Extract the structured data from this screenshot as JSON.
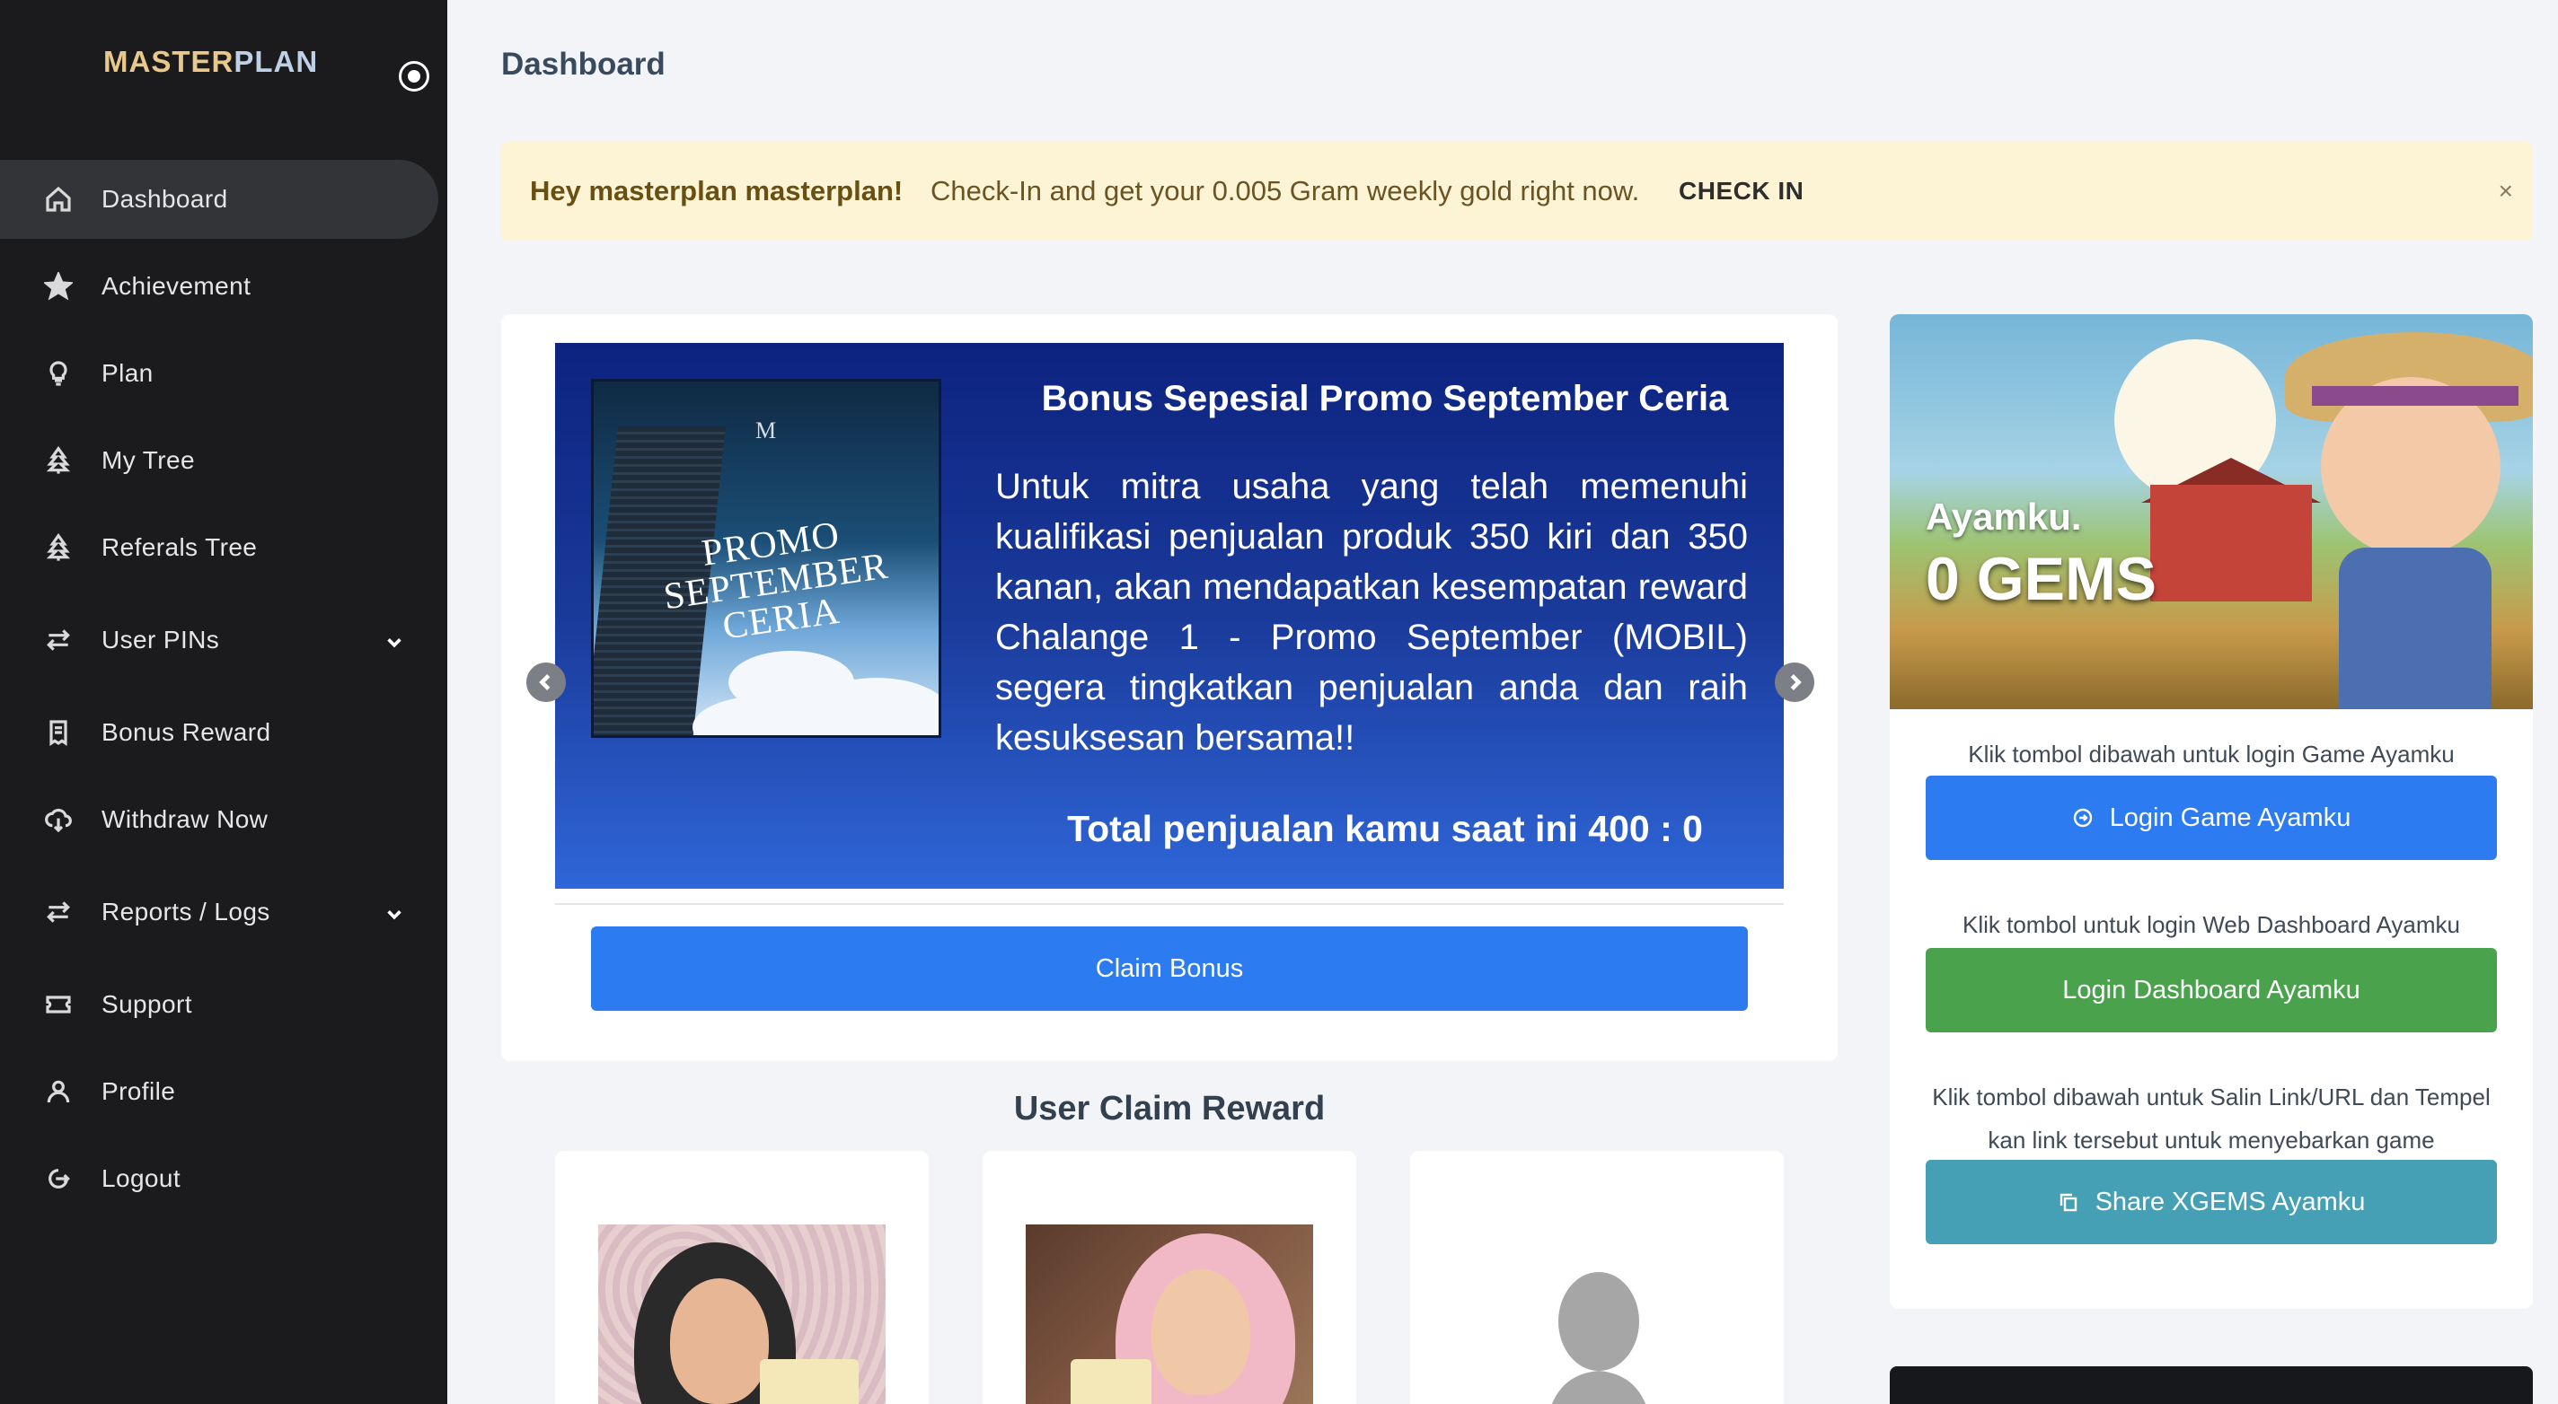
{
  "app": {
    "logo_master": "MASTER",
    "logo_plan": "PLAN"
  },
  "sidebar": {
    "items": [
      {
        "label": "Dashboard",
        "icon": "home-icon",
        "active": true
      },
      {
        "label": "Achievement",
        "icon": "star-icon"
      },
      {
        "label": "Plan",
        "icon": "lightbulb-icon"
      },
      {
        "label": "My Tree",
        "icon": "tree-icon"
      },
      {
        "label": "Referals Tree",
        "icon": "tree-icon"
      },
      {
        "label": "User PINs",
        "icon": "swap-icon",
        "has_submenu": true
      },
      {
        "label": "Bonus Reward",
        "icon": "receipt-icon"
      },
      {
        "label": "Withdraw Now",
        "icon": "cloud-download-icon"
      },
      {
        "label": "Reports / Logs",
        "icon": "swap-icon",
        "has_submenu": true
      },
      {
        "label": "Support",
        "icon": "ticket-icon"
      },
      {
        "label": "Profile",
        "icon": "user-icon"
      },
      {
        "label": "Logout",
        "icon": "logout-icon"
      }
    ]
  },
  "header": {
    "title": "Dashboard"
  },
  "alert": {
    "greeting": "Hey masterplan masterplan!",
    "message": "Check-In and get your 0.005 Gram weekly gold right now.",
    "action": "CHECK IN",
    "close": "×"
  },
  "promo": {
    "image_text": "PROMO SEPTEMBER CERIA",
    "image_logo": "M",
    "title": "Bonus Sepesial Promo September Ceria",
    "body": "Untuk mitra usaha yang telah memenuhi kualifikasi penjualan produk 350 kiri dan 350 kanan, akan mendapatkan kesempatan reward Chalange 1 - Promo September (MOBIL) segera tingkatkan penjualan anda dan raih kesuksesan bersama!!",
    "total": "Total penjualan kamu saat ini 400 : 0",
    "claim_button": "Claim Bonus"
  },
  "claims": {
    "heading": "User Claim Reward"
  },
  "game": {
    "label": "Ayamku.",
    "gems": "0 GEMS",
    "hint_login_game": "Klik tombol dibawah untuk login Game Ayamku",
    "btn_login_game": "Login Game Ayamku",
    "hint_login_web": "Klik tombol untuk login Web Dashboard Ayamku",
    "btn_login_web": "Login Dashboard Ayamku",
    "hint_share": "Klik tombol dibawah untuk Salin Link/URL dan Tempel kan link tersebut untuk menyebarkan game",
    "btn_share": "Share XGEMS Ayamku"
  },
  "colors": {
    "primary": "#2c7bf0",
    "success": "#4aa24c",
    "info": "#45a0b5",
    "sidebar": "#1b1b1e",
    "alert_bg": "#fdf3d5"
  }
}
